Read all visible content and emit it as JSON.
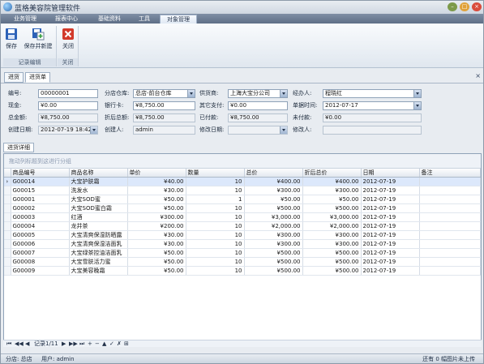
{
  "app": {
    "title": "蓝格美容院管理软件"
  },
  "menu": {
    "tabs": [
      "业务管理",
      "报表中心",
      "基础资料",
      "工具",
      "对象管理"
    ]
  },
  "ribbon": {
    "save": "保存",
    "save_new": "保存并新建",
    "close": "关闭",
    "group_record": "记录编辑",
    "group_close": "关闭"
  },
  "subtabs": [
    "进货",
    "进货单"
  ],
  "form": {
    "no_label": "编号:",
    "no_value": "00000001",
    "warehouse_label": "分店仓库:",
    "warehouse_value": "总店-前台仓库",
    "supplier_label": "供货商:",
    "supplier_value": "上海大宝分公司",
    "handler_label": "经办人:",
    "handler_value": "程晓红",
    "cash_label": "现金:",
    "cash_value": "¥0.00",
    "bankcard_label": "银行卡:",
    "bankcard_value": "¥8,750.00",
    "other_label": "其它支付:",
    "other_value": "¥0.00",
    "datetime_label": "单据时间:",
    "datetime_value": "2012-07-17",
    "total_label": "总金额:",
    "total_value": "¥8,750.00",
    "disc_total_label": "折后总额:",
    "disc_total_value": "¥8,750.00",
    "paid_label": "已付款:",
    "paid_value": "¥8,750.00",
    "unpaid_label": "未付款:",
    "unpaid_value": "¥0.00",
    "created_label": "创建日期:",
    "created_value": "2012-07-19 18:42",
    "creator_label": "创建人:",
    "creator_value": "admin",
    "modified_label": "修改日期:",
    "modified_value": "",
    "modifier_label": "修改人:",
    "modifier_value": ""
  },
  "detail": {
    "tab": "进货详细",
    "group_hint": "拖动列标题到这进行分组"
  },
  "table": {
    "headers": [
      "商品编号",
      "商品名称",
      "单价",
      "数量",
      "总价",
      "折后总价",
      "日期",
      "备注"
    ],
    "rows": [
      [
        "G00014",
        "大宝护肤霜",
        "¥40.00",
        "10",
        "¥400.00",
        "¥400.00",
        "2012-07-19",
        ""
      ],
      [
        "G00015",
        "洗发水",
        "¥30.00",
        "10",
        "¥300.00",
        "¥300.00",
        "2012-07-19",
        ""
      ],
      [
        "G00001",
        "大宝SOD蜜",
        "¥50.00",
        "1",
        "¥50.00",
        "¥50.00",
        "2012-07-19",
        ""
      ],
      [
        "G00002",
        "大宝SOD蜜白霜",
        "¥50.00",
        "10",
        "¥500.00",
        "¥500.00",
        "2012-07-19",
        ""
      ],
      [
        "G00003",
        "红酒",
        "¥300.00",
        "10",
        "¥3,000.00",
        "¥3,000.00",
        "2012-07-19",
        ""
      ],
      [
        "G00004",
        "龙井茶",
        "¥200.00",
        "10",
        "¥2,000.00",
        "¥2,000.00",
        "2012-07-19",
        ""
      ],
      [
        "G00005",
        "大宝清爽保湿防晒露",
        "¥30.00",
        "10",
        "¥300.00",
        "¥300.00",
        "2012-07-19",
        ""
      ],
      [
        "G00006",
        "大宝清爽保湿洁面乳",
        "¥30.00",
        "10",
        "¥300.00",
        "¥300.00",
        "2012-07-19",
        ""
      ],
      [
        "G00007",
        "大宝绿茶控油洁面乳",
        "¥50.00",
        "10",
        "¥500.00",
        "¥500.00",
        "2012-07-19",
        ""
      ],
      [
        "G00008",
        "大宝雪肤活力蜜",
        "¥50.00",
        "10",
        "¥500.00",
        "¥500.00",
        "2012-07-19",
        ""
      ],
      [
        "G00009",
        "大宝美容晚霜",
        "¥50.00",
        "10",
        "¥500.00",
        "¥500.00",
        "2012-07-19",
        ""
      ]
    ]
  },
  "navigator": {
    "record": "记录1/11"
  },
  "status": {
    "branch": "分店: 总店",
    "user": "用户: admin",
    "images": "还有 0 幅图片未上传"
  }
}
